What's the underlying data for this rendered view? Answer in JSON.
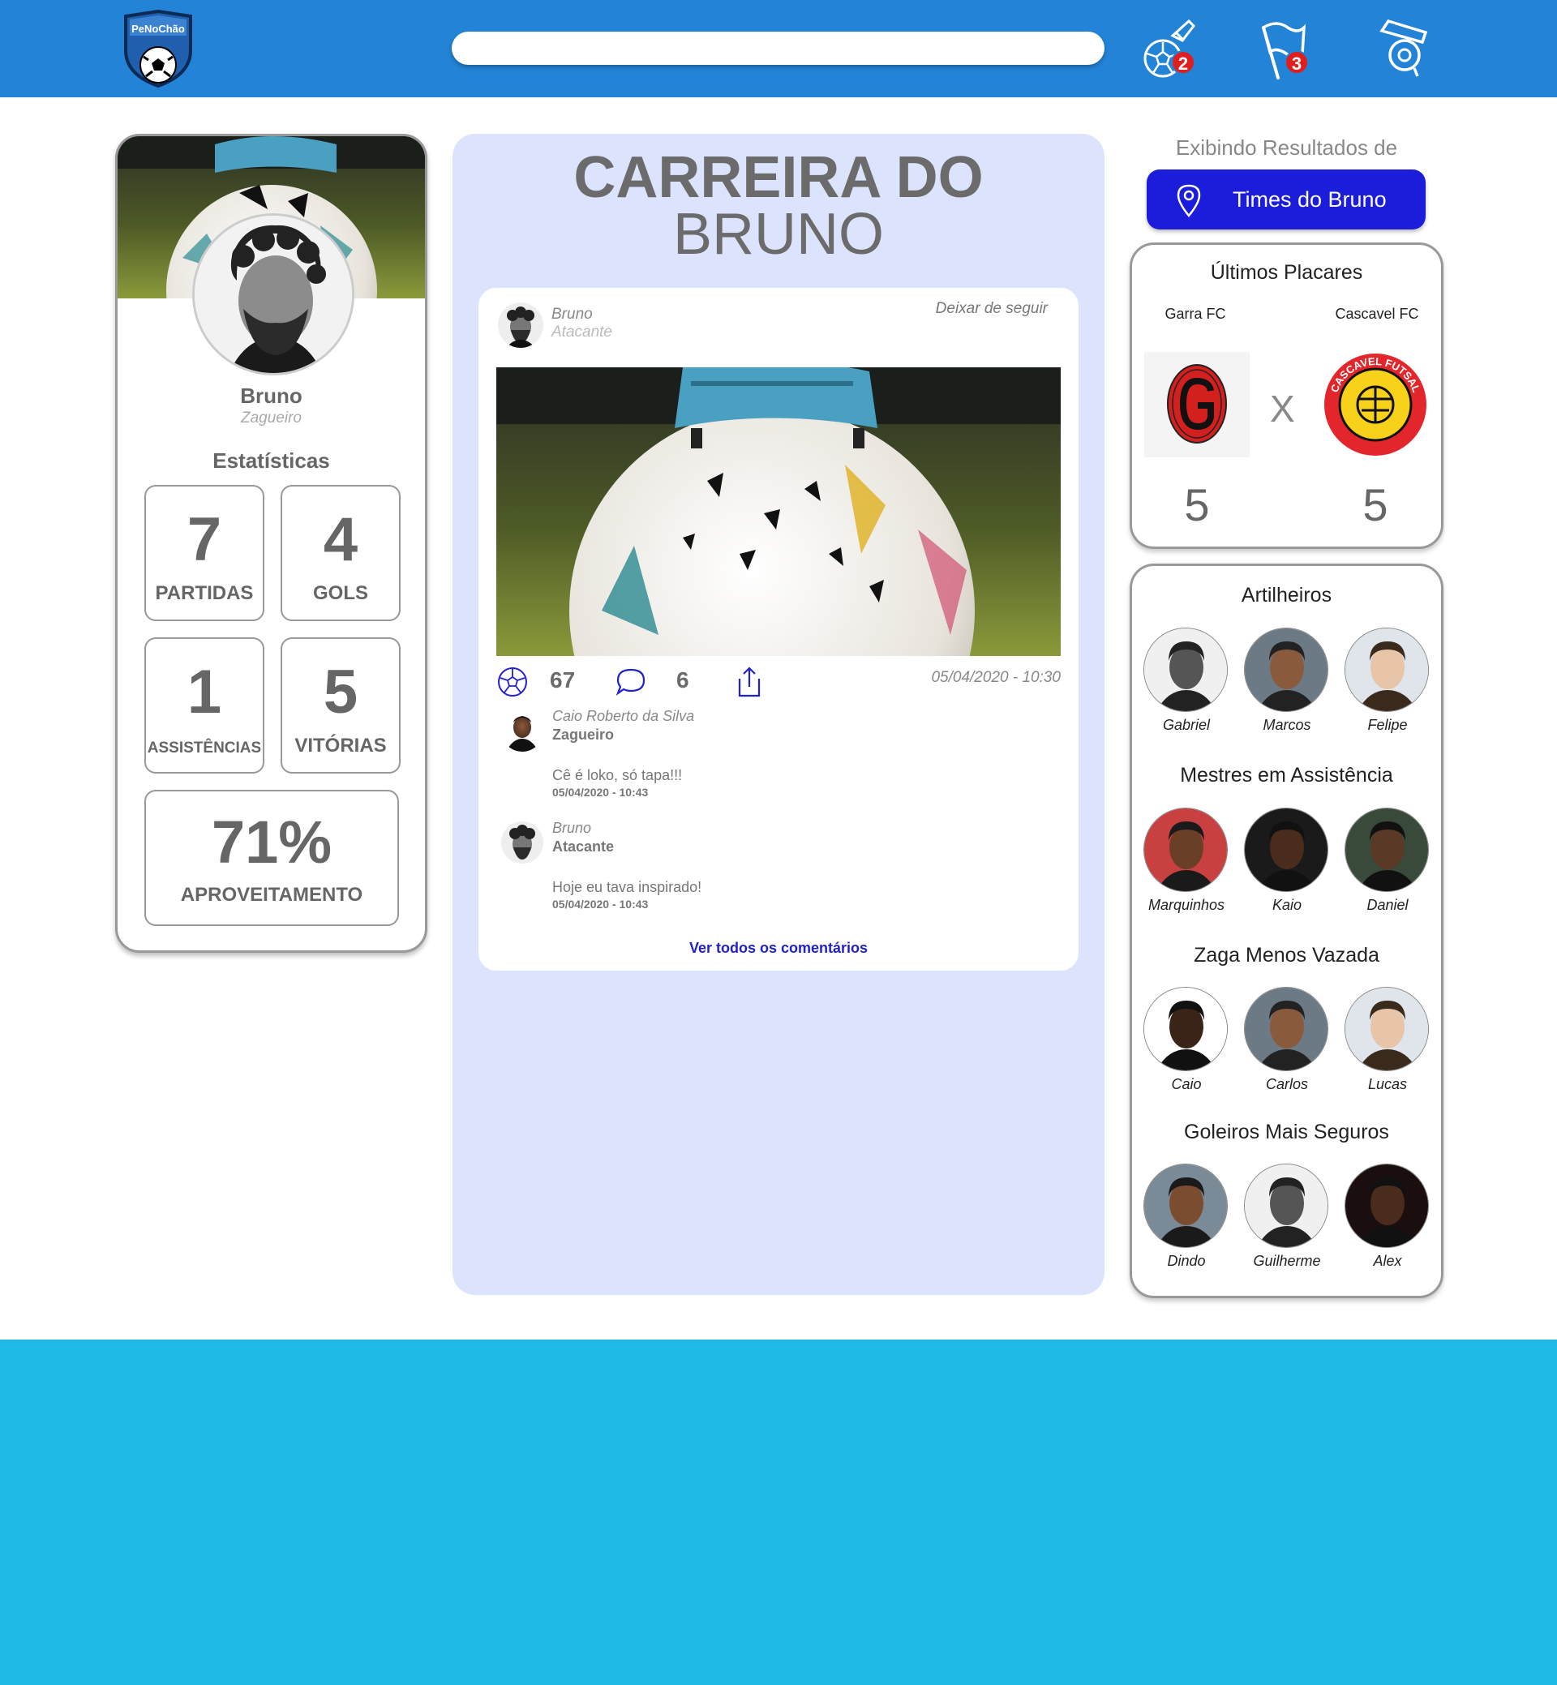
{
  "header": {
    "logo_text": "PeNoChão",
    "search": {
      "value": "",
      "placeholder": ""
    },
    "icons": [
      {
        "name": "ball-notifications-icon",
        "badge": "2"
      },
      {
        "name": "flag-notifications-icon",
        "badge": "3"
      },
      {
        "name": "whistle-icon",
        "badge": ""
      }
    ],
    "brand_color": "#2383d6"
  },
  "profile": {
    "name": "Bruno",
    "role": "Zagueiro",
    "stats_title": "Estatísticas",
    "stats": [
      {
        "value": "7",
        "label": "PARTIDAS"
      },
      {
        "value": "4",
        "label": "GOLS"
      },
      {
        "value": "1",
        "label": "ASSISTÊNCIAS"
      },
      {
        "value": "5",
        "label": "VITÓRIAS"
      },
      {
        "value": "71%",
        "label": "APROVEITAMENTO"
      }
    ]
  },
  "feed": {
    "title_line1": "CARREIRA DO",
    "title_line2": "BRUNO",
    "post": {
      "author": "Bruno",
      "role": "Atacante",
      "unfollow_label": "Deixar de seguir",
      "likes": "67",
      "comments_count": "6",
      "date": "05/04/2020 - 10:30",
      "comments": [
        {
          "name": "Caio Roberto da Silva",
          "role": "Zagueiro",
          "text": "Cê é loko, só tapa!!!",
          "date": "05/04/2020 - 10:43"
        },
        {
          "name": "Bruno",
          "role": "Atacante",
          "text": "Hoje eu tava inspirado!",
          "date": "05/04/2020 - 10:43"
        }
      ],
      "see_all_label": "Ver todos os comentários"
    }
  },
  "sidebar": {
    "results_label": "Exibindo Resultados de",
    "team_button_label": "Times do Bruno",
    "last_scores": {
      "title": "Últimos Placares",
      "home": {
        "name": "Garra FC",
        "score": "5"
      },
      "away": {
        "name": "Cascavel FC",
        "score": "5",
        "badge_text": "CASCAVEL FUTSAL"
      },
      "vs": "X"
    },
    "rankings": [
      {
        "title": "Artilheiros",
        "players": [
          "Gabriel",
          "Marcos",
          "Felipe"
        ]
      },
      {
        "title": "Mestres em Assistência",
        "players": [
          "Marquinhos",
          "Kaio",
          "Daniel"
        ]
      },
      {
        "title": "Zaga Menos Vazada",
        "players": [
          "Caio",
          "Carlos",
          "Lucas"
        ]
      },
      {
        "title": "Goleiros Mais Seguros",
        "players": [
          "Dindo",
          "Guilherme",
          "Alex"
        ]
      }
    ]
  },
  "colors": {
    "accent_button": "#1c1cdb",
    "feed_background": "#dbe3fd",
    "footer_band": "#1fb9e5",
    "badge": "#e01e1e"
  }
}
